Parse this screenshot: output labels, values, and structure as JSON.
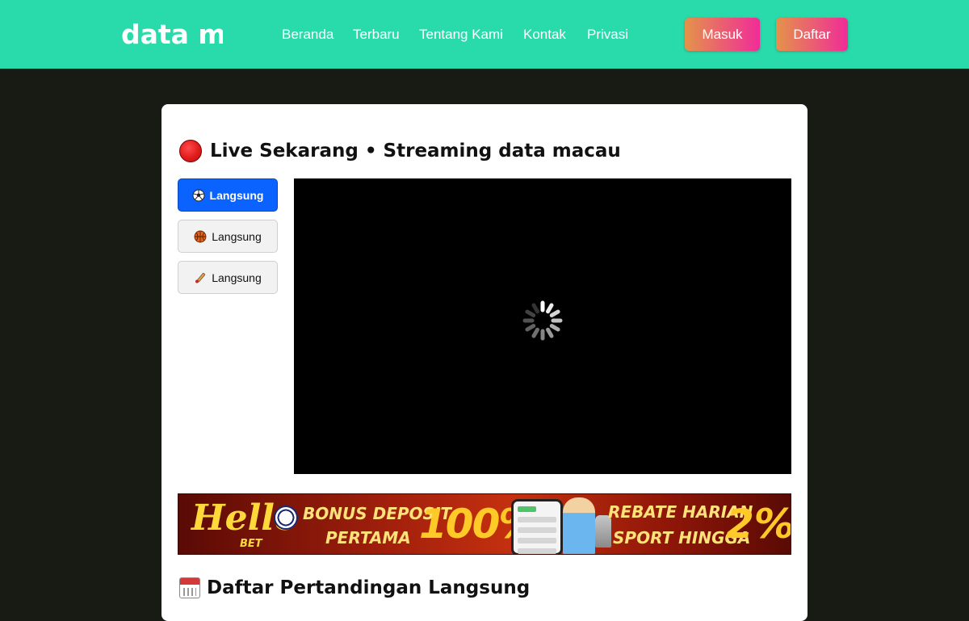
{
  "header": {
    "logo": "data macau",
    "nav": [
      "Beranda",
      "Terbaru",
      "Tentang Kami",
      "Kontak",
      "Privasi"
    ],
    "login_label": "Masuk",
    "register_label": "Daftar",
    "bg_color": "#29dbab",
    "button_gradient": [
      "#e4934a",
      "#f02c98"
    ]
  },
  "live": {
    "title": "Live Sekarang • Streaming data macau",
    "tabs": [
      {
        "icon": "soccer-ball-icon",
        "label": "Langsung",
        "active": true
      },
      {
        "icon": "basketball-icon",
        "label": "Langsung",
        "active": false
      },
      {
        "icon": "cricket-bat-icon",
        "label": "Langsung",
        "active": false
      }
    ],
    "player_state": "loading"
  },
  "banner": {
    "brand": "Hello",
    "brand_sub": "BET",
    "promo1_line1": "BONUS DEPOSIT",
    "promo1_line2": "PERTAMA",
    "promo1_value": "100%",
    "promo2_line1": "REBATE HARIAN",
    "promo2_line2": "SPORT HINGGA",
    "promo2_value": "2%"
  },
  "match_list": {
    "title": "Daftar Pertandingan Langsung"
  }
}
